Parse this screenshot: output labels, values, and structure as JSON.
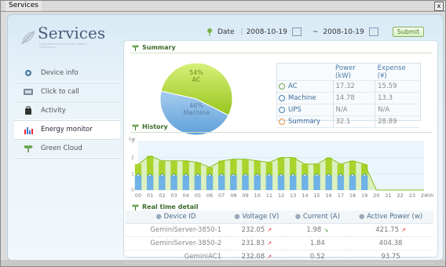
{
  "window": {
    "title": "Services",
    "close_glyph": "x"
  },
  "app": {
    "name": "Services",
    "tagline": "Energy-efficient cloud and lean platform infrastructure"
  },
  "sidebar": {
    "items": [
      {
        "label": "Device info",
        "icon": "device-icon",
        "active": false
      },
      {
        "label": "Click to call",
        "icon": "phone-icon",
        "active": false
      },
      {
        "label": "Activity",
        "icon": "activity-icon",
        "active": false
      },
      {
        "label": "Energy monitor",
        "icon": "chart-icon",
        "active": true
      },
      {
        "label": "Green Cloud",
        "icon": "leaf-icon",
        "active": false
      }
    ]
  },
  "datebar": {
    "label": "Date",
    "from": "2008-10-19",
    "tilde": "~",
    "to": "2008-10-19",
    "submit": "Submit"
  },
  "summary": {
    "title": "Summary",
    "pie": {
      "slices": [
        {
          "name": "AC",
          "percent": 54,
          "color": "#a9d23a"
        },
        {
          "name": "Machine",
          "percent": 46,
          "color": "#7fb3e0"
        }
      ],
      "ac_label": "54%",
      "ac_name": "AC",
      "machine_label": "46%",
      "machine_name": "Machine"
    },
    "columns": [
      "Power (kW)",
      "Expense (¥)"
    ],
    "rows": [
      {
        "label": "AC",
        "power": "17.32",
        "expense": "15.59",
        "dot": "#6aa84f"
      },
      {
        "label": "Machine",
        "power": "14.78",
        "expense": "13.3",
        "dot": "#4a7da8"
      },
      {
        "label": "UPS",
        "power": "N/A",
        "expense": "N/A",
        "dot": "#4a7da8"
      },
      {
        "label": "Summary",
        "power": "32.1",
        "expense": "28.89",
        "dot": "#e69138"
      }
    ]
  },
  "history": {
    "title": "History",
    "ylabel": "kw",
    "chart_data": {
      "type": "bar",
      "ylim": [
        0,
        3
      ],
      "yticks": [
        "0",
        "1",
        "2",
        "3"
      ],
      "categories": [
        "00",
        "01",
        "02",
        "03",
        "04",
        "05",
        "06",
        "07",
        "08",
        "09",
        "10",
        "11",
        "12",
        "13",
        "14",
        "15",
        "16",
        "17",
        "18",
        "19",
        "20",
        "21",
        "22",
        "23",
        "24"
      ],
      "x_unit": "hh",
      "series": [
        {
          "name": "AC",
          "values": [
            1.6,
            2.1,
            1.8,
            1.8,
            1.8,
            1.7,
            1.4,
            1.8,
            1.9,
            1.9,
            1.8,
            1.7,
            2.0,
            2.0,
            1.6,
            1.6,
            2.0,
            1.6,
            1.8,
            1.6,
            0,
            0,
            0,
            0,
            0
          ],
          "color": "#a8d42c"
        },
        {
          "name": "Machine",
          "values": [
            0.9,
            0.9,
            0.9,
            0.9,
            0.9,
            0.9,
            0.9,
            0.9,
            0.9,
            0.9,
            0.9,
            0.9,
            0.9,
            0.9,
            0.9,
            0.9,
            0.9,
            0.9,
            0.9,
            0.9,
            0,
            0,
            0,
            0,
            0
          ],
          "color": "#6fb2e8"
        }
      ],
      "grid": true
    }
  },
  "realtime": {
    "title": "Real time detail",
    "columns": [
      "Device ID",
      "Voltage (V)",
      "Current (A)",
      "Active Power (w)"
    ],
    "rows": [
      {
        "id": "GeminiServer-3850-1",
        "voltage": "232.05",
        "v_trend": "up",
        "current": "1.98",
        "c_trend": "down",
        "power": "421.75",
        "p_trend": "up"
      },
      {
        "id": "GeminiServer-3850-2",
        "voltage": "231.83",
        "v_trend": "up",
        "current": "1.84",
        "c_trend": "",
        "power": "404.38",
        "p_trend": ""
      },
      {
        "id": "GeminiAC1",
        "voltage": "232.08",
        "v_trend": "up",
        "current": "0.52",
        "c_trend": "",
        "power": "93.75",
        "p_trend": ""
      }
    ]
  },
  "trend_glyphs": {
    "up": "↗",
    "down": "↘"
  }
}
